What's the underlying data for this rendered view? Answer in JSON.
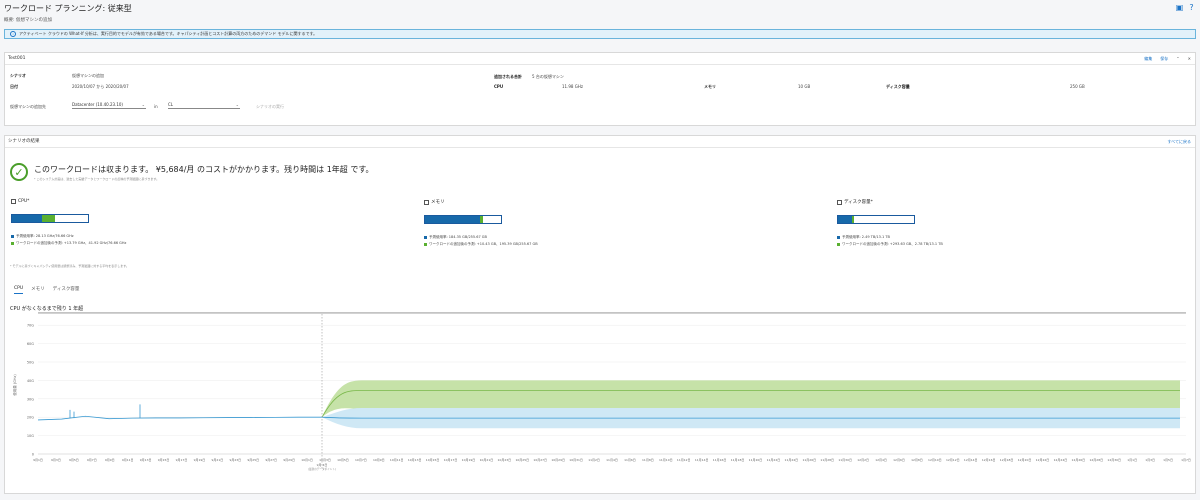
{
  "header": {
    "title": "ワークロード プランニング: 従来型",
    "subtitle": "概要: 仮想マシンの追加",
    "help_icon": "help-icon",
    "layout_icon": "layout-icon"
  },
  "banner": {
    "text": "アクティベート クラウドの What-If 分析は、実行目的でモデルが有効である場合です。キャパシティ計画とコスト計算の両方のためのデマンド モデルに関するです。"
  },
  "scenario_card": {
    "title": "Test001",
    "actions": {
      "edit": "編集",
      "save": "保存"
    },
    "scenario_label": "シナリオ",
    "scenario_value": "仮想マシンの追加",
    "date_label": "日付",
    "date_value": "2020/10/07 から 2020/20/07",
    "added_total_label": "追加される合計",
    "added_total_value": "5 台の仮想マシン",
    "cpu_label": "CPU",
    "cpu_value": "11.98 GHz",
    "memory_label": "メモリ",
    "memory_value": "10 GB",
    "disk_label": "ディスク容量",
    "disk_value": "250 GB",
    "vm_target_label": "仮想マシンの追加先",
    "datacenter_select": "Datacenter (10.40.23.10)",
    "in_label": "in",
    "cluster_select": "CL",
    "run_link": "シナリオの実行"
  },
  "result_card": {
    "title": "シナリオの結果",
    "action": "すべてに戻る",
    "status_main": "このワークロードは収まります。 ¥5,684/月 のコストがかかります。残り時間は 1年超 です。",
    "status_sub": "* このシステム計画は、過去した実績データとワークロードの反映の予測範囲に基づきます。",
    "footnote": "* モデルに基づくキャパシティ使用量は調整済み、予測範囲に対する平均を表示します。",
    "resources": [
      {
        "label": "CPU*",
        "icon": "cpu-icon",
        "used_pct": 0.39,
        "added_pct": 0.18,
        "line1": "予測使用率: 28.13 GHz/76.66 GHz",
        "line2": "ワークロードの追加後の予測: +13.79 GHz、41.92 GHz/76.66 GHz"
      },
      {
        "label": "メモリ",
        "icon": "memory-icon",
        "used_pct": 0.72,
        "added_pct": 0.04,
        "line1": "予測使用率: 184.35 GB/255.67 GB",
        "line2": "ワークロードの追加後の予測: +10.43 GB、195.39 GB/255.67 GB"
      },
      {
        "label": "ディスク容量*",
        "icon": "disk-icon",
        "used_pct": 0.18,
        "added_pct": 0.03,
        "line1": "予測使用率: 2.49 TB/13.1 TB",
        "line2": "ワークロードの追加後の予測: +293.63 GB、2.78 TB/13.1 TB"
      }
    ],
    "tabs": [
      "CPU",
      "メモリ",
      "ディスク容量"
    ],
    "active_tab": "CPU",
    "chart_title": "CPU がなくなるまで残り 1 年超"
  },
  "colors": {
    "used": "#1769aa",
    "added": "#5ab030",
    "green_band": "#c6e2a8",
    "blue_band": "#cfe8f5",
    "accent": "#1a73c7"
  },
  "chart_data": {
    "type": "area",
    "ylabel": "使用量 (GHz)",
    "yticks": [
      "0",
      "10G",
      "20G",
      "30G",
      "40G",
      "50G",
      "60G",
      "70G"
    ],
    "ylim": [
      0,
      75
    ],
    "capacity": 76.66,
    "now_label": "9月 4日",
    "now_sublabel": "(最新のデータポイント)",
    "history": {
      "x": [
        "9月 4日",
        "9月 11日",
        "9月 18日",
        "9月 25日",
        "10月 2日",
        "10月 9日",
        "10月 16日",
        "10月 23日",
        "10月 30日",
        "11月 6日",
        "11月 13日",
        "11月 20日",
        "11月 27日"
      ],
      "y": [
        18.5,
        19.0,
        20.5,
        19.2,
        19.5,
        19.6,
        19.6,
        19.7,
        19.8,
        19.8,
        19.9,
        20.0,
        20.0
      ]
    },
    "forecast_combined": {
      "center": 34.5,
      "upper": 40.0,
      "lower": 24.5
    },
    "forecast_base": {
      "center": 19.5,
      "upper": 25.0,
      "lower": 14.0
    },
    "x_labels": [
      "9月1日",
      "9月3日",
      "9月5日",
      "9月7日",
      "9月9日",
      "9月11日",
      "9月13日",
      "9月15日",
      "9月17日",
      "9月19日",
      "9月21日",
      "9月23日",
      "9月25日",
      "9月27日",
      "9月29日",
      "10月1日",
      "10月3日",
      "10月5日",
      "10月7日",
      "10月9日",
      "10月11日",
      "10月13日",
      "10月15日",
      "10月17日",
      "10月19日",
      "10月21日",
      "10月23日",
      "10月25日",
      "10月27日",
      "10月29日",
      "10月31日",
      "11月2日",
      "11月4日",
      "11月6日",
      "11月8日",
      "11月10日",
      "11月12日",
      "11月14日",
      "11月16日",
      "11月18日",
      "11月20日",
      "11月22日",
      "11月24日",
      "11月26日",
      "11月28日",
      "11月30日",
      "12月2日",
      "12月4日",
      "12月6日",
      "12月8日",
      "12月10日",
      "12月12日",
      "12月14日",
      "12月16日",
      "12月18日",
      "12月20日",
      "12月22日",
      "12月24日",
      "12月26日",
      "12月28日",
      "12月30日",
      "1月1日",
      "1月3日",
      "1月5日",
      "1月7日"
    ]
  }
}
